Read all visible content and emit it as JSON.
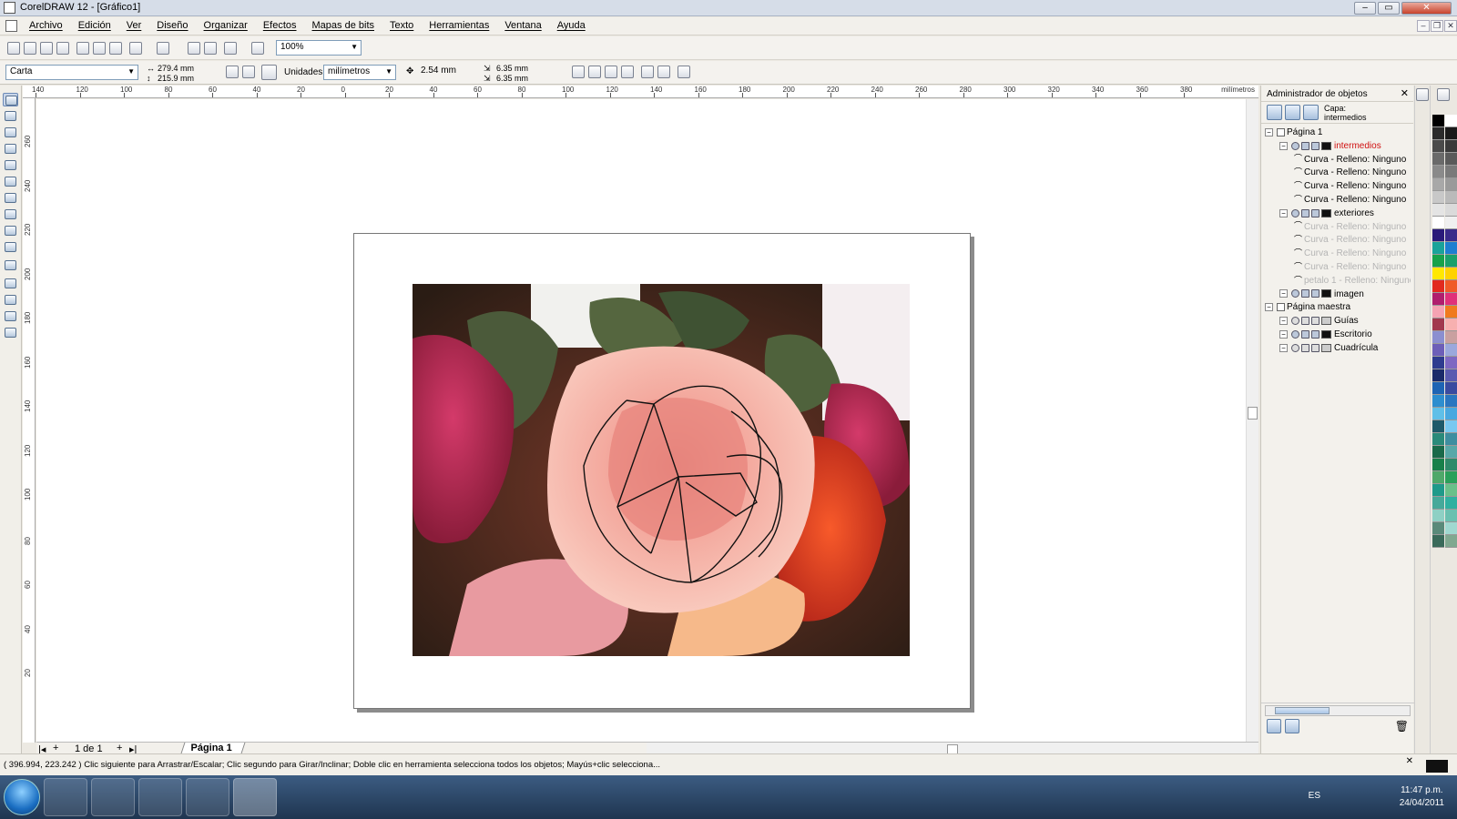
{
  "window": {
    "title": "CorelDRAW 12 - [Gráfico1]"
  },
  "menubar": {
    "items": [
      "Archivo",
      "Edición",
      "Ver",
      "Diseño",
      "Organizar",
      "Efectos",
      "Mapas de bits",
      "Texto",
      "Herramientas",
      "Ventana",
      "Ayuda"
    ]
  },
  "toolbar": {
    "zoom": "100%"
  },
  "propertybar": {
    "paper_size": "Carta",
    "width": "279.4 mm",
    "height": "215.9 mm",
    "units_label": "Unidades:",
    "units_value": "milímetros",
    "nudge": "2.54 mm",
    "dup_x": "6.35 mm",
    "dup_y": "6.35 mm"
  },
  "ruler": {
    "units": "milímetros",
    "h_labels": [
      "140",
      "120",
      "100",
      "80",
      "60",
      "40",
      "20",
      "0",
      "20",
      "40",
      "60",
      "80",
      "100",
      "120",
      "140",
      "160",
      "180",
      "200",
      "220",
      "240",
      "260",
      "280",
      "300",
      "320",
      "340",
      "360",
      "380"
    ],
    "v_labels": [
      "260",
      "240",
      "220",
      "200",
      "180",
      "160",
      "140",
      "120",
      "100",
      "80",
      "60",
      "40",
      "20"
    ]
  },
  "page_nav": {
    "counter": "1 de 1",
    "tab": "Página 1"
  },
  "object_manager": {
    "title": "Administrador de objetos",
    "layer_label": "Capa:",
    "layer_value": "intermedios",
    "tree": [
      {
        "label": "Página 1",
        "level": 0,
        "type": "page",
        "expanded": true
      },
      {
        "label": "intermedios",
        "level": 1,
        "type": "layer",
        "expanded": true,
        "active": true,
        "swatch": "#111111"
      },
      {
        "label": "Curva - Relleno: Ninguno",
        "level": 2,
        "type": "curve"
      },
      {
        "label": "Curva - Relleno: Ninguno",
        "level": 2,
        "type": "curve"
      },
      {
        "label": "Curva - Relleno: Ninguno",
        "level": 2,
        "type": "curve"
      },
      {
        "label": "Curva - Relleno: Ninguno",
        "level": 2,
        "type": "curve"
      },
      {
        "label": "exteriores",
        "level": 1,
        "type": "layer",
        "expanded": true,
        "swatch": "#111111"
      },
      {
        "label": "Curva - Relleno: Ninguno",
        "level": 2,
        "type": "curve",
        "dimmed": true
      },
      {
        "label": "Curva - Relleno: Ninguno",
        "level": 2,
        "type": "curve",
        "dimmed": true
      },
      {
        "label": "Curva - Relleno: Ninguno",
        "level": 2,
        "type": "curve",
        "dimmed": true
      },
      {
        "label": "Curva - Relleno: Ninguno",
        "level": 2,
        "type": "curve",
        "dimmed": true
      },
      {
        "label": "petalo 1 - Relleno: Ninguno",
        "level": 2,
        "type": "curve",
        "dimmed": true
      },
      {
        "label": "imagen",
        "level": 1,
        "type": "layer",
        "expanded": true,
        "swatch": "#111111"
      },
      {
        "label": "Página maestra",
        "level": 0,
        "type": "page",
        "expanded": true
      },
      {
        "label": "Guías",
        "level": 1,
        "type": "layer",
        "swatch": "#cccccc"
      },
      {
        "label": "Escritorio",
        "level": 1,
        "type": "layer",
        "swatch": "#111111"
      },
      {
        "label": "Cuadrícula",
        "level": 1,
        "type": "layer",
        "swatch": "#cccccc"
      }
    ]
  },
  "status": {
    "text": "( 396.994, 223.242 )     Clic siguiente para Arrastrar/Escalar; Clic segundo para Girar/Inclinar; Doble clic en herramienta selecciona todos los objetos; Mayús+clic selecciona..."
  },
  "taskbar": {
    "language": "ES",
    "time": "11:47 p.m.",
    "date": "24/04/2011"
  },
  "palette": {
    "left": [
      "#000000",
      "#2b2b2b",
      "#4a4a4a",
      "#6a6a6a",
      "#8a8a8a",
      "#a8a8a8",
      "#c8c8c8",
      "#e4e4e4",
      "#ffffff",
      "#2a1a7a",
      "#1aa39a",
      "#17a24a",
      "#ffe800",
      "#e22a1f",
      "#b01e6e",
      "#f5a3b3",
      "#a2384e",
      "#8b8fd0",
      "#6d5fb8",
      "#2e3b8f",
      "#1a2a6a",
      "#1e64b4",
      "#2d8ecf",
      "#5fbfe8",
      "#1e5a6a",
      "#2a8a7a",
      "#1a6a4a",
      "#18804a",
      "#4fa86a",
      "#1f9a8a",
      "#46a99a",
      "#8ed0c4",
      "#5a8a7a",
      "#3a6a5a"
    ],
    "right": [
      "#ffffff",
      "#1a1a1a",
      "#3a3a3a",
      "#5a5a5a",
      "#7a7a7a",
      "#9a9a9a",
      "#bababa",
      "#dadada",
      "#f0f0f0",
      "#3a2a8a",
      "#1e7fd0",
      "#1aa06a",
      "#ffd200",
      "#f05a28",
      "#e0307a",
      "#f07a1e",
      "#f7b0b0",
      "#c9a0a0",
      "#9ba8dc",
      "#7e68c2",
      "#5a5ab0",
      "#3a4aa0",
      "#2a76c0",
      "#48a8e0",
      "#79c8f0",
      "#3e8ea0",
      "#58a8a8",
      "#2f8a6a",
      "#2aa05a",
      "#6ac08a",
      "#30b0a0",
      "#6ac0b0",
      "#a0d8d0",
      "#80a890"
    ]
  }
}
